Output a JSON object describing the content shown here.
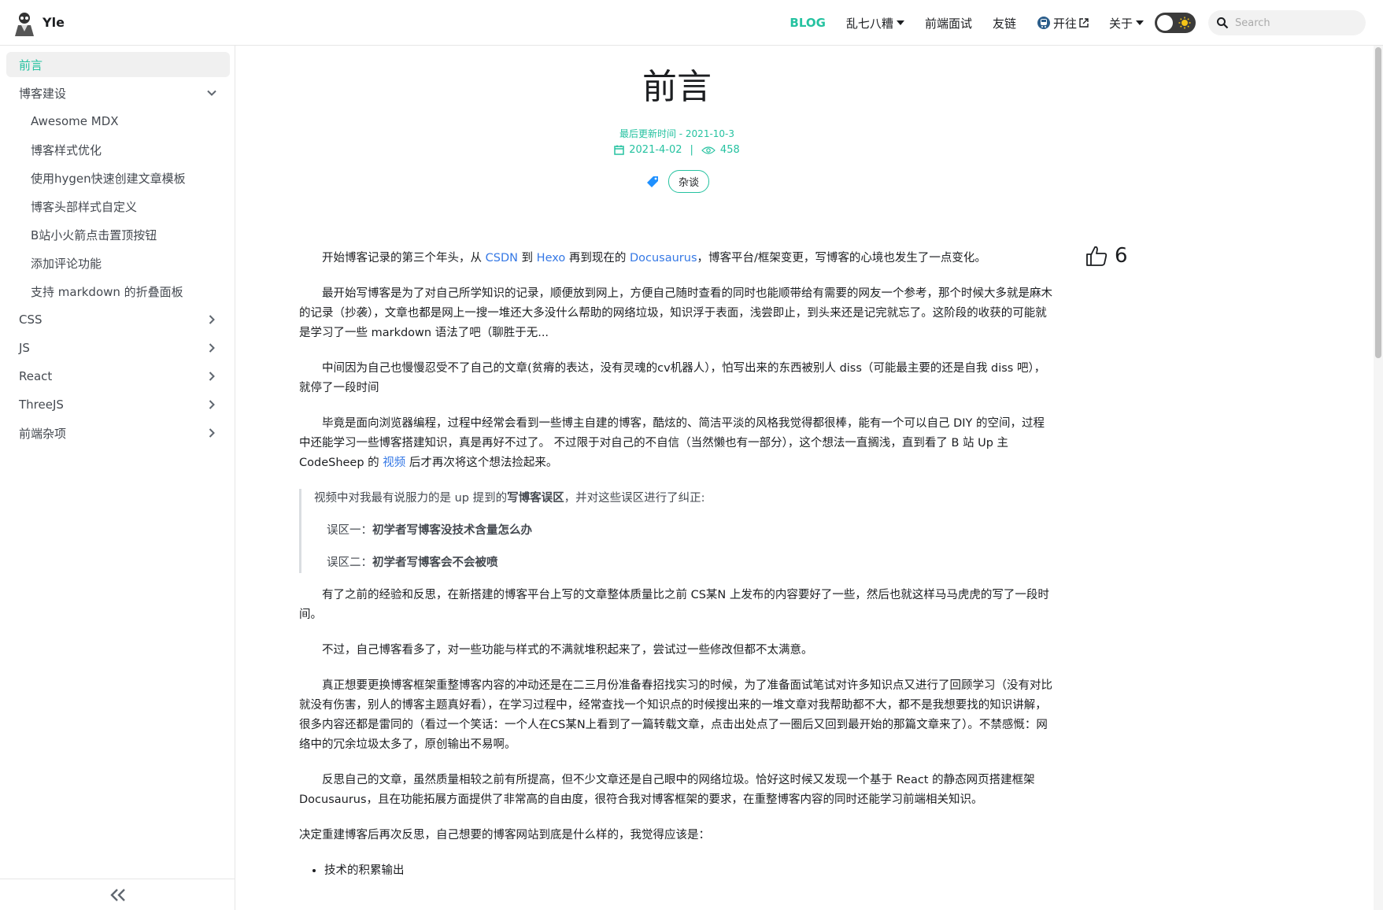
{
  "navbar": {
    "brand_title": "Yle",
    "items": [
      {
        "label": "BLOG",
        "active": true
      },
      {
        "label": "乱七八糟",
        "dropdown": true
      },
      {
        "label": "前端面试"
      },
      {
        "label": "友链"
      },
      {
        "label": "开往",
        "external": true
      },
      {
        "label": "关于",
        "dropdown": true
      }
    ],
    "search_placeholder": "Search"
  },
  "sidebar": {
    "items": [
      {
        "label": "前言",
        "active": true
      },
      {
        "label": "博客建设",
        "expanded": true
      },
      {
        "label": "Awesome MDX",
        "sub": true
      },
      {
        "label": "博客样式优化",
        "sub": true
      },
      {
        "label": "使用hygen快速创建文章模板",
        "sub": true
      },
      {
        "label": "博客头部样式自定义",
        "sub": true
      },
      {
        "label": "B站小火箭点击置顶按钮",
        "sub": true
      },
      {
        "label": "添加评论功能",
        "sub": true
      },
      {
        "label": "支持 markdown 的折叠面板",
        "sub": true
      },
      {
        "label": "CSS"
      },
      {
        "label": "JS"
      },
      {
        "label": "React"
      },
      {
        "label": "ThreeJS"
      },
      {
        "label": "前端杂项"
      }
    ]
  },
  "article": {
    "title": "前言",
    "updated": "最后更新时间 - 2021-10-3",
    "date": "2021-4-02",
    "views": "458",
    "tag": "杂谈",
    "likes": "6",
    "p1": {
      "a": "开始博客记录的第三个年头，从 ",
      "l1": "CSDN",
      "b": " 到 ",
      "l2": "Hexo",
      "c": " 再到现在的 ",
      "l3": "Docusaurus",
      "d": "，博客平台/框架变更，写博客的心境也发生了一点变化。"
    },
    "p2": "最开始写博客是为了对自己所学知识的记录，顺便放到网上，方便自己随时查看的同时也能顺带给有需要的网友一个参考，那个时候大多就是麻木的记录（抄袭），文章也都是网上一搜一堆还大多没什么帮助的网络垃圾，知识浮于表面，浅尝即止，到头来还是记完就忘了。这阶段的收获的可能就是学习了一些 markdown 语法了吧（聊胜于无...",
    "p3": "中间因为自己也慢慢忍受不了自己的文章(贫瘠的表达，没有灵魂的cv机器人），怕写出来的东西被别人 diss（可能最主要的还是自我 diss 吧），就停了一段时间",
    "p4": {
      "a": "毕竟是面向浏览器编程，过程中经常会看到一些博主自建的博客，酷炫的、简洁平淡的风格我觉得都很棒，能有一个可以自己 DIY 的空间，过程中还能学习一些博客搭建知识，真是再好不过了。 不过限于对自己的不自信（当然懒也有一部分），这个想法一直搁浅，直到看了 B 站 Up 主 CodeSheep 的 ",
      "link": "视频",
      "b": " 后才再次将这个想法捡起来。"
    },
    "quote": {
      "intro_a": "视频中对我最有说服力的是 up 提到的",
      "intro_bold": "写博客误区",
      "intro_b": "，并对这些误区进行了纠正:",
      "e1_label": "误区一：",
      "e1_text": "初学者写博客没技术含量怎么办",
      "e2_label": "误区二：",
      "e2_text": "初学者写博客会不会被喷"
    },
    "p5": "有了之前的经验和反思，在新搭建的博客平台上写的文章整体质量比之前 CS某N 上发布的内容要好了一些，然后也就这样马马虎虎的写了一段时间。",
    "p6": "不过，自己博客看多了，对一些功能与样式的不满就堆积起来了，尝试过一些修改但都不太满意。",
    "p7": "真正想要更换博客框架重整博客内容的冲动还是在二三月份准备春招找实习的时候，为了准备面试笔试对许多知识点又进行了回顾学习（没有对比就没有伤害，别人的博客主题真好看），在学习过程中，经常查找一个知识点的时候搜出来的一堆文章对我帮助都不大，都不是我想要找的知识讲解，很多内容还都是雷同的（看过一个笑话：一个人在CS某N上看到了一篇转载文章，点击出处点了一圈后又回到最开始的那篇文章来了）。不禁感慨：网络中的冗余垃圾太多了，原创输出不易啊。",
    "p8": "反思自己的文章，虽然质量相较之前有所提高，但不少文章还是自己眼中的网络垃圾。恰好这时候又发现一个基于 React 的静态网页搭建框架 Docusaurus，且在功能拓展方面提供了非常高的自由度，很符合我对博客框架的要求，在重整博客内容的同时还能学习前端相关知识。",
    "p9": "决定重建博客后再次反思，自己想要的博客网站到底是什么样的，我觉得应该是：",
    "list": [
      "技术的积累输出"
    ]
  },
  "colors": {
    "accent": "#25c2a0",
    "link": "#3578e5",
    "text": "#1c1e21"
  }
}
